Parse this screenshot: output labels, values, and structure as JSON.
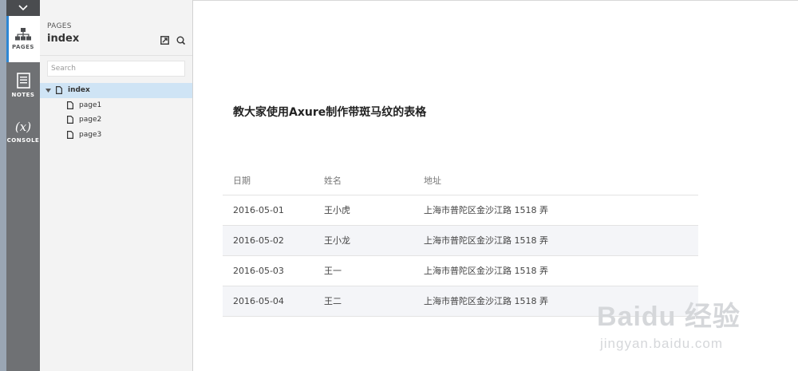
{
  "rail": {
    "pages_label": "PAGES",
    "notes_label": "NOTES",
    "console_glyph": "(x)",
    "console_label": "CONSOLE"
  },
  "panel": {
    "eyebrow": "PAGES",
    "title": "index",
    "search_placeholder": "Search",
    "tree": {
      "root": "index",
      "children": [
        "page1",
        "page2",
        "page3"
      ]
    }
  },
  "main": {
    "heading": "教大家使用Axure制作带斑马纹的表格",
    "table": {
      "headers": [
        "日期",
        "姓名",
        "地址"
      ],
      "rows": [
        [
          "2016-05-01",
          "王小虎",
          "上海市普陀区金沙江路 1518 弄"
        ],
        [
          "2016-05-02",
          "王小龙",
          "上海市普陀区金沙江路 1518 弄"
        ],
        [
          "2016-05-03",
          "王一",
          "上海市普陀区金沙江路 1518 弄"
        ],
        [
          "2016-05-04",
          "王二",
          "上海市普陀区金沙江路 1518 弄"
        ]
      ]
    }
  },
  "watermark": {
    "brand": "Baidu 经验",
    "url": "jingyan.baidu.com"
  },
  "colors": {
    "accent": "#2d86d4",
    "rail": "#6f7174",
    "selected_row": "#cfe4f5",
    "stripe": "#f4f5f8"
  },
  "icons": [
    "chevron-down-icon",
    "sitemap-icon",
    "notes-icon",
    "export-icon",
    "add-page-icon",
    "caret-down-icon",
    "page-icon"
  ]
}
